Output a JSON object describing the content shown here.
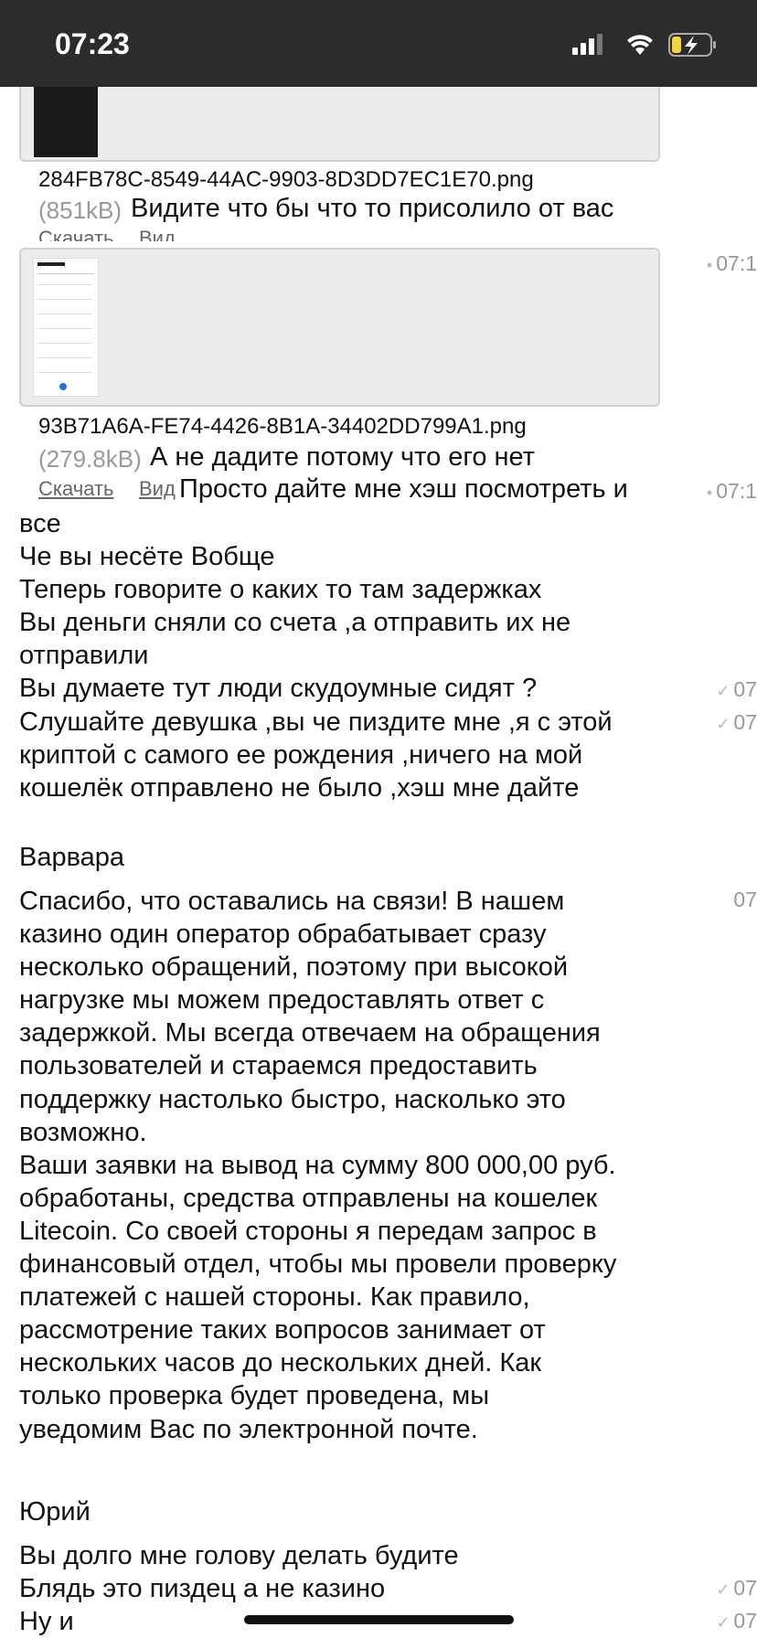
{
  "status_bar": {
    "time": "07:23"
  },
  "attachments": [
    {
      "filename": "284FB78C-8549-44AC-9903-8D3DD7EC1E70.png",
      "size": "(851kB)",
      "caption": "Видите что бы что то присолило от вас",
      "download_label": "Скачать",
      "view_label": "Вид"
    },
    {
      "filename": "93B71A6A-FE74-4426-8B1A-34402DD799A1.png",
      "size": "(279.8kB)",
      "caption": "А не дадите потому что его нет",
      "download_label": "Скачать",
      "view_label": "Вид",
      "timestamp": "07:1"
    }
  ],
  "user_messages_1": {
    "timestamp_first": "07:1",
    "line_inline": "Просто дайте мне хэш посмотреть и",
    "lines": [
      "все",
      "Че вы несёте Вобще",
      "Теперь говорите о каких то там задержках",
      "Вы деньги сняли со счета ,а отправить их не",
      "отправили",
      "Вы думаете тут люди скудоумные сидят ?",
      "Слушайте девушка ,вы че пиздите мне ,я с этой",
      "криптой с самого ее рождения ,ничего на мой",
      "кошелёк отправлено не было ,хэш мне дайте"
    ],
    "ts_question": "07",
    "ts_listen": "07"
  },
  "operator": {
    "name": "Варвара",
    "timestamp": "07",
    "lines": [
      "Спасибо, что оставались на связи! В нашем",
      "казино один оператор обрабатывает сразу",
      "несколько обращений, поэтому при высокой",
      "нагрузке мы можем предоставлять ответ с",
      "задержкой. Мы всегда отвечаем на обращения",
      "пользователей и стараемся предоставить",
      "поддержку настолько быстро, насколько это",
      "возможно.",
      "Ваши заявки на вывод на сумму 800 000,00 руб.",
      "обработаны, средства отправлены на кошелек",
      "Litecoin.  Со своей стороны я передам запрос в",
      "финансовый отдел, чтобы мы провели проверку",
      "платежей с нашей стороны. Как правило,",
      "рассмотрение таких вопросов занимает от",
      "нескольких часов до нескольких дней. Как",
      "только проверка будет проведена, мы",
      "уведомим Вас по электронной почте."
    ]
  },
  "user2": {
    "name": "Юрий",
    "messages": [
      {
        "text": "Вы долго мне голову делать будите",
        "timestamp": ""
      },
      {
        "text": "Блядь это пиздец а не казино",
        "timestamp": "07"
      },
      {
        "text": "Ну и",
        "timestamp": "07"
      }
    ]
  }
}
